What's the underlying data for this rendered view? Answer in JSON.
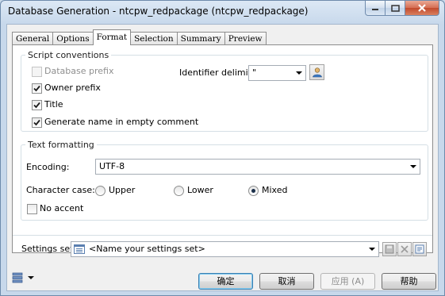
{
  "window": {
    "title": "Database Generation - ntcpw_redpackage (ntcpw_redpackage)"
  },
  "tabs": [
    {
      "label": "General"
    },
    {
      "label": "Options"
    },
    {
      "label": "Format"
    },
    {
      "label": "Selection"
    },
    {
      "label": "Summary"
    },
    {
      "label": "Preview"
    }
  ],
  "active_tab": "Format",
  "script_conventions": {
    "title": "Script conventions",
    "database_prefix": {
      "label": "Database prefix",
      "checked": false,
      "enabled": false
    },
    "owner_prefix": {
      "label": "Owner prefix",
      "checked": true
    },
    "title_opt": {
      "label": "Title",
      "checked": true
    },
    "generate_name": {
      "label": "Generate name in empty comment",
      "checked": true
    },
    "identifier_delimiter": {
      "label": "Identifier delimiter:",
      "value": "\""
    }
  },
  "text_formatting": {
    "title": "Text formatting",
    "encoding": {
      "label": "Encoding:",
      "value": "UTF-8"
    },
    "character_case": {
      "label": "Character case:",
      "options": [
        "Upper",
        "Lower",
        "Mixed"
      ],
      "selected": "Mixed"
    },
    "no_accent": {
      "label": "No accent",
      "checked": false
    }
  },
  "settings_set": {
    "label": "Settings set:",
    "placeholder": "<Name your settings set>"
  },
  "buttons": {
    "ok": "确定",
    "cancel": "取消",
    "apply": "应用 (A)",
    "help": "帮助"
  },
  "colors": {
    "accent": "#3c7fb1",
    "titlebar": "#c7d8eb",
    "close": "#c24a2c"
  }
}
